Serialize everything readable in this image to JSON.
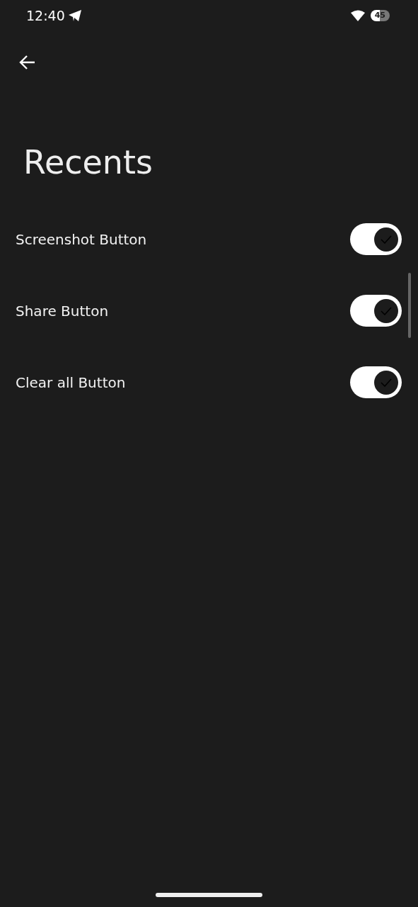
{
  "status_bar": {
    "time": "12:40",
    "battery": "45"
  },
  "title": "Recents",
  "settings": [
    {
      "label": "Screenshot Button",
      "on": true
    },
    {
      "label": "Share Button",
      "on": true
    },
    {
      "label": "Clear all Button",
      "on": true
    }
  ]
}
